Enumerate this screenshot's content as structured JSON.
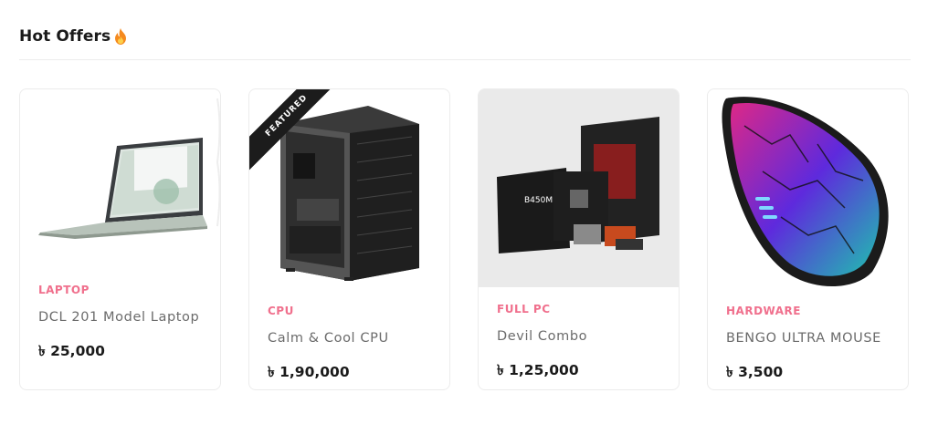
{
  "section": {
    "title": "Hot Offers",
    "title_icon": "fire-icon"
  },
  "products": [
    {
      "category": "LAPTOP",
      "name": "DCL 201 Model Laptop",
      "price": "৳ 25,000",
      "image": "laptop-image"
    },
    {
      "category": "CPU",
      "name": "Calm & Cool CPU",
      "price": "৳ 1,90,000",
      "image": "pc-case-image",
      "badge": "FEATURED"
    },
    {
      "category": "FULL PC",
      "name": "Devil Combo",
      "price": "৳ 1,25,000",
      "image": "pc-combo-image"
    },
    {
      "category": "HARDWARE",
      "name": "BENGO ULTRA MOUSE",
      "price": "৳ 3,500",
      "image": "gaming-mouse-image"
    }
  ],
  "colors": {
    "category": "#f0708d",
    "price": "#1a1a1a",
    "name": "#6b6b6b",
    "fire": "#f58a1f"
  }
}
